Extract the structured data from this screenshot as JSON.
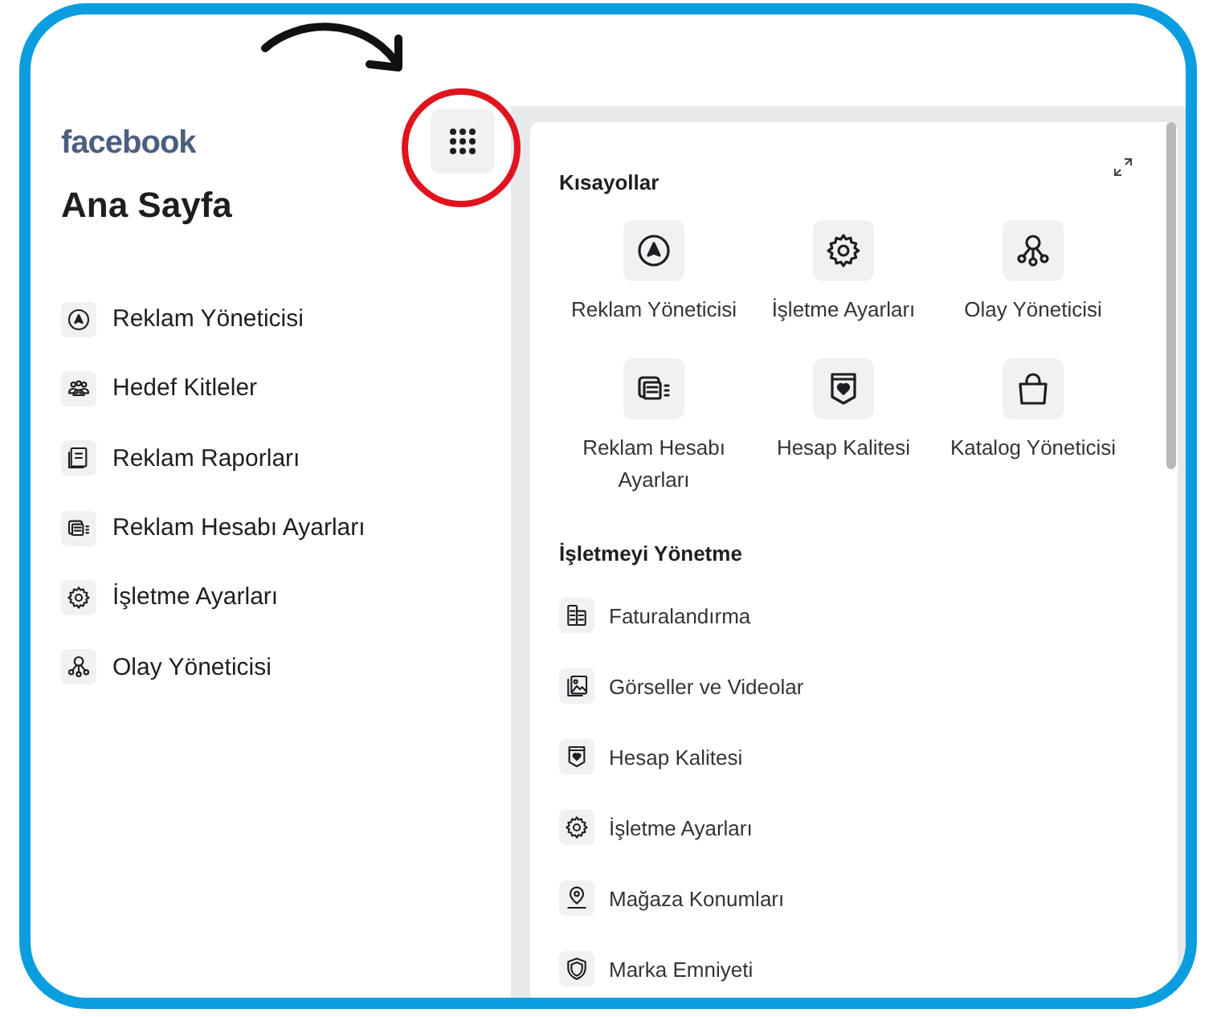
{
  "brand": {
    "logo": "facebook"
  },
  "page_title": "Ana Sayfa",
  "nav": [
    {
      "label": "Reklam Yöneticisi"
    },
    {
      "label": "Hedef Kitleler"
    },
    {
      "label": "Reklam Raporları"
    },
    {
      "label": "Reklam Hesabı Ayarları"
    },
    {
      "label": "İşletme Ayarları"
    },
    {
      "label": "Olay Yöneticisi"
    }
  ],
  "shortcuts": {
    "title": "Kısayollar",
    "items": [
      {
        "label": "Reklam Yöneticisi"
      },
      {
        "label": "İşletme Ayarları"
      },
      {
        "label": "Olay Yöneticisi"
      },
      {
        "label": "Reklam Hesabı Ayarları"
      },
      {
        "label": "Hesap Kalitesi"
      },
      {
        "label": "Katalog Yöneticisi"
      }
    ]
  },
  "manage": {
    "title": "İşletmeyi Yönetme",
    "items": [
      {
        "label": "Faturalandırma"
      },
      {
        "label": "Görseller ve Videolar"
      },
      {
        "label": "Hesap Kalitesi"
      },
      {
        "label": "İşletme Ayarları"
      },
      {
        "label": "Mağaza Konumları"
      },
      {
        "label": "Marka Emniyeti"
      }
    ]
  }
}
